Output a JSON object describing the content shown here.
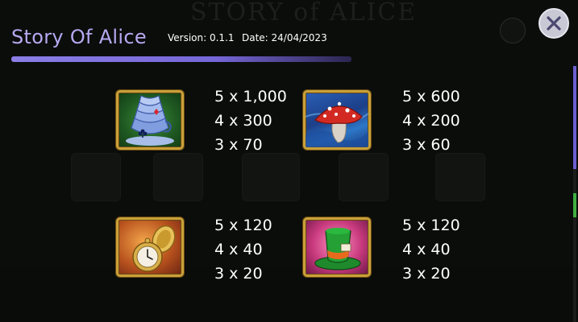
{
  "header": {
    "title": "Story Of Alice",
    "version": "Version: 0.1.1",
    "date": "Date: 24/04/2023"
  },
  "close_button": {
    "icon": "close-icon"
  },
  "scrollbar": {
    "color": "#6b5fd0"
  },
  "colors": {
    "title": "#b7a8f0",
    "frame_gold": "#c9a03a",
    "rule": "#8b7ee6"
  },
  "symbols": [
    {
      "name": "teacups",
      "icon": "stacked-teacups-icon",
      "payouts": [
        "5 x 1,000",
        "4 x 300",
        "3 x 70"
      ]
    },
    {
      "name": "mushroom",
      "icon": "red-mushroom-icon",
      "payouts": [
        "5 x 600",
        "4 x 200",
        "3 x 60"
      ]
    },
    {
      "name": "pocket-watch",
      "icon": "pocket-watch-icon",
      "payouts": [
        "5 x 120",
        "4 x 40",
        "3 x 20"
      ]
    },
    {
      "name": "mad-hatter-hat",
      "icon": "top-hat-icon",
      "payouts": [
        "5 x 120",
        "4 x 40",
        "3 x 20"
      ]
    }
  ]
}
